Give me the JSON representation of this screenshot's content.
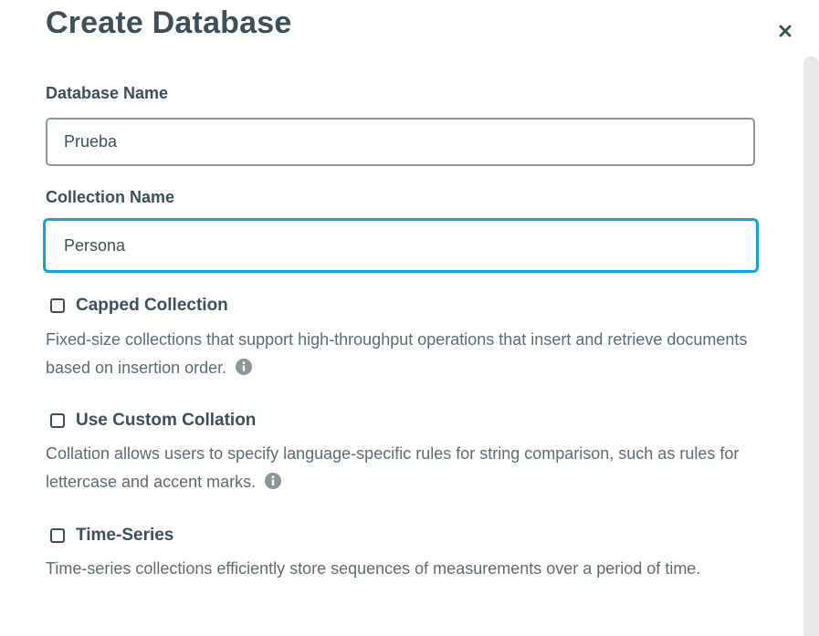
{
  "modal": {
    "title": "Create Database",
    "close_icon": "close-icon"
  },
  "fields": {
    "database_name": {
      "label": "Database Name",
      "value": "Prueba"
    },
    "collection_name": {
      "label": "Collection Name",
      "value": "Persona"
    }
  },
  "options": [
    {
      "label": "Capped Collection",
      "checked": false,
      "description": "Fixed-size collections that support high-throughput operations that insert and retrieve documents based on insertion order.",
      "icon": "info-icon"
    },
    {
      "label": "Use Custom Collation",
      "checked": false,
      "description": "Collation allows users to specify language-specific rules for string comparison, such as rules for lettercase and accent marks.",
      "icon": "info-icon"
    },
    {
      "label": "Time-Series",
      "checked": false,
      "description": "Time-series collections efficiently store sequences of measurements over a period of time."
    }
  ],
  "colors": {
    "text": "#3d4f58",
    "muted_text": "#5d6c74",
    "focus_border": "#0ea5e0",
    "input_border": "#89979b"
  }
}
